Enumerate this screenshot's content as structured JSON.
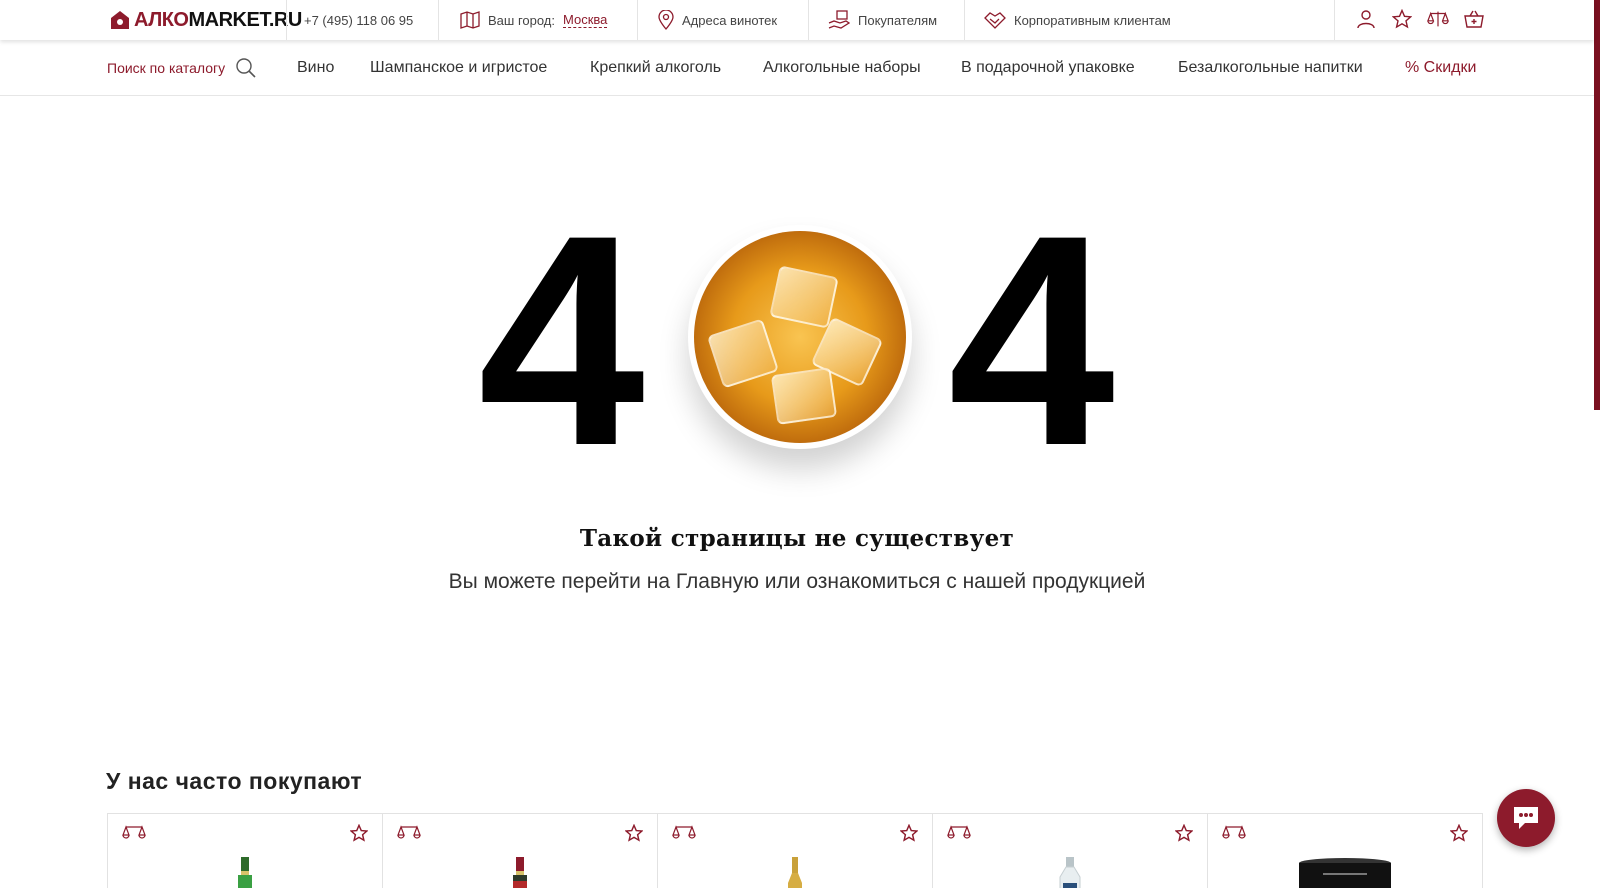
{
  "header": {
    "logo": {
      "prefix": "АЛКО",
      "suffix": "MARKET.RU"
    },
    "phone": "+7 (495) 118 06 95",
    "city_label": "Ваш город:",
    "city_value": "Москва",
    "addresses": "Адреса винотек",
    "customers": "Покупателям",
    "corporate": "Корпоративным клиентам",
    "icons": [
      "user-icon",
      "star-icon",
      "compare-icon",
      "basket-icon"
    ]
  },
  "nav": {
    "search_label": "Поиск по каталогу",
    "items": [
      "Вино",
      "Шампанское и игристое",
      "Крепкий алкоголь",
      "Алкогольные наборы",
      "В подарочной упаковке",
      "Безалкогольные напитки",
      "% Скидки"
    ]
  },
  "error": {
    "digit_left": "4",
    "digit_right": "4",
    "title": "Такой страницы не существует",
    "subtitle": "Вы можете перейти на Главную или ознакомиться с нашей продукцией"
  },
  "popular": {
    "title": "У нас часто покупают",
    "cards": [
      {
        "bottle": "green-bottle"
      },
      {
        "bottle": "red-label-bottle"
      },
      {
        "bottle": "gold-bottle"
      },
      {
        "bottle": "clear-bottle"
      },
      {
        "bottle": "black-tube"
      }
    ]
  },
  "colors": {
    "brand": "#8d1b2c",
    "text": "#333333"
  }
}
